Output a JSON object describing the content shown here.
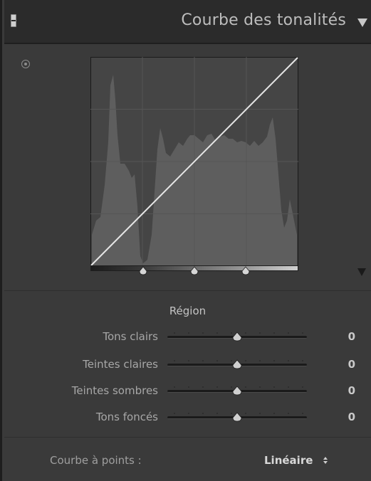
{
  "panel": {
    "title": "Courbe des tonalités"
  },
  "icons": {
    "panel_toggle": "panel-collapse-icon",
    "panel_menu": "triangle-down-icon",
    "target": "target-adjustment-icon",
    "expand": "triangle-down-icon"
  },
  "region": {
    "title": "Région",
    "sliders": [
      {
        "label": "Tons clairs",
        "value": "0",
        "position": 0.5
      },
      {
        "label": "Teintes claires",
        "value": "0",
        "position": 0.5
      },
      {
        "label": "Teintes sombres",
        "value": "0",
        "position": 0.5
      },
      {
        "label": "Tons foncés",
        "value": "0",
        "position": 0.5
      }
    ]
  },
  "split_points": [
    0.25,
    0.5,
    0.75
  ],
  "footer": {
    "label": "Courbe à points :",
    "value": "Linéaire"
  },
  "colors": {
    "panel_bg": "#3a3a3a",
    "header_bg": "#2b2b2b",
    "histogram": "#5f5f5f",
    "curve_line": "#e6e6e6"
  }
}
